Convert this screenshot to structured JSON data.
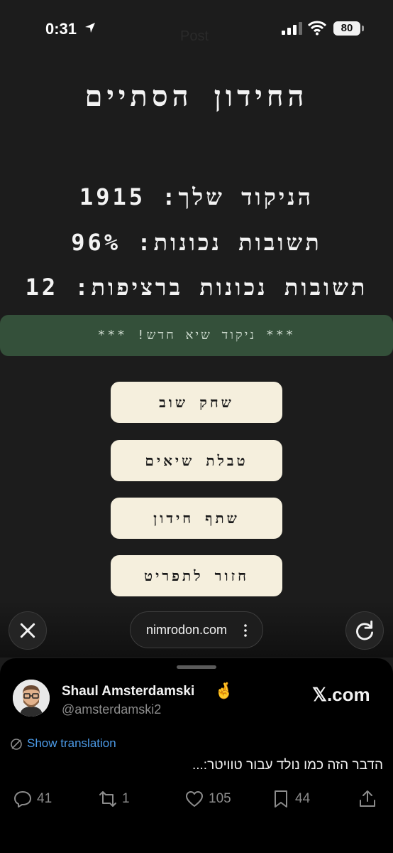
{
  "status_bar": {
    "time": "0:31",
    "ghost_title": "Post",
    "battery": "80"
  },
  "game": {
    "title": "החידון הסתיים",
    "score_line": "הניקוד שלך: 1915",
    "correct_line": "תשובות נכונות: 96%",
    "streak_line": "תשובות נכונות ברציפות: 12",
    "record_banner": "*** ניקוד שיא חדש! ***",
    "buttons": {
      "play_again": "שחק שוב",
      "leaderboard": "טבלת שיאים",
      "share": "שתף חידון",
      "back_to_menu": "חזור לתפריט"
    }
  },
  "browser_bar": {
    "url": "nimrodon.com"
  },
  "tweet": {
    "author_name": "Shaul Amsterdamski",
    "author_emoji": "🤞",
    "handle": "@amsterdamski2",
    "source": "𝕏.com",
    "translate_label": "Show translation",
    "text": "הדבר הזה כמו נולד עבור טוויטר:...",
    "counts": {
      "replies": "41",
      "reposts": "1",
      "likes": "105",
      "bookmarks": "44"
    }
  }
}
